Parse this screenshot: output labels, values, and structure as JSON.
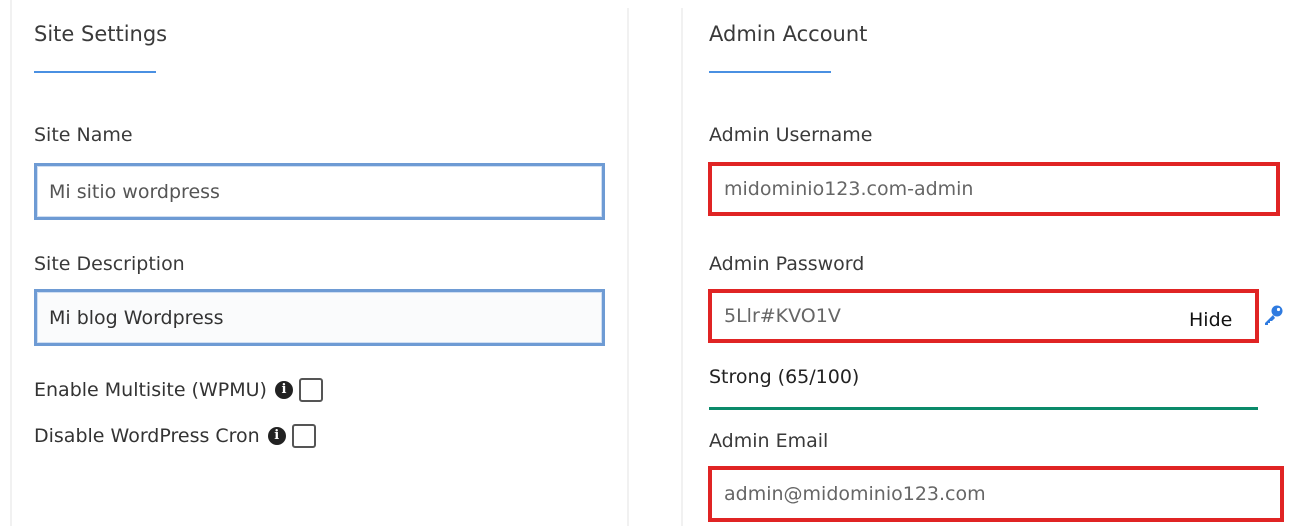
{
  "site_settings": {
    "title": "Site Settings",
    "site_name_label": "Site Name",
    "site_name_value": "Mi sitio wordpress",
    "site_description_label": "Site Description",
    "site_description_value": "Mi blog Wordpress",
    "enable_multisite_label": "Enable Multisite (WPMU)",
    "disable_cron_label": "Disable WordPress Cron",
    "info_glyph": "i"
  },
  "admin_account": {
    "title": "Admin Account",
    "username_label": "Admin Username",
    "username_value": "midominio123.com-admin",
    "password_label": "Admin Password",
    "password_value": "5Llr#KVO1V",
    "hide_label": "Hide",
    "strength_text": "Strong (65/100)",
    "email_label": "Admin Email",
    "email_value": "admin@midominio123.com"
  },
  "colors": {
    "accent": "#4a90e2",
    "error_border": "#e02424",
    "strength_good": "#0a8a6a"
  }
}
